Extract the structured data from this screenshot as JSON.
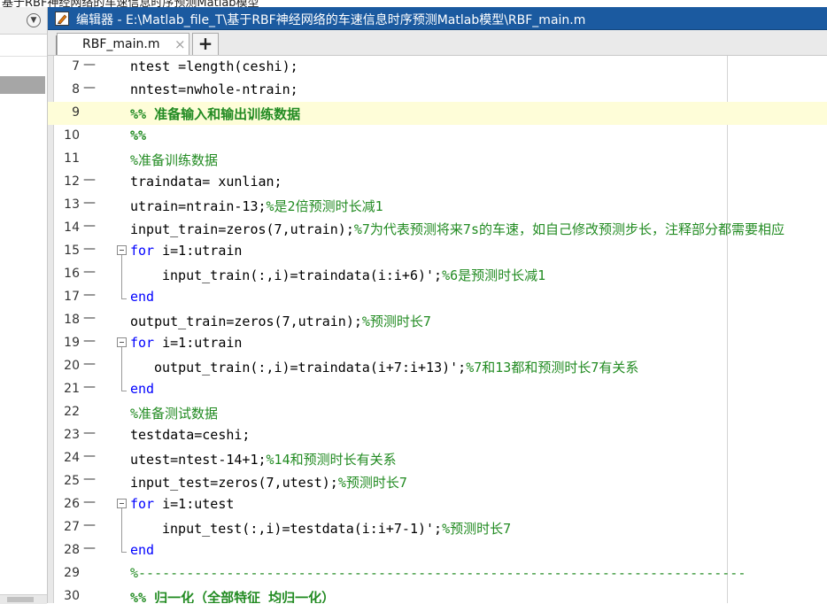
{
  "window": {
    "title_fragment": "基于RBF神经网络的车速信息时序预测Matlab模型"
  },
  "editor": {
    "title": "编辑器 - E:\\Matlab_file_T\\基于RBF神经网络的车速信息时序预测Matlab模型\\RBF_main.m",
    "tab_label": "RBF_main.m",
    "tab_close": "×",
    "add_tab": "+"
  },
  "colors": {
    "keyword": "#0000ff",
    "comment": "#228b22",
    "title_bar": "#1b5aa0",
    "cell_highlight": "#fefdd8"
  },
  "icons": {
    "editor_icon": "editor-pencil-icon",
    "panel_menu": "chevron-down-icon"
  },
  "code_lines": [
    {
      "n": "7",
      "dash": "—",
      "indent": 0,
      "fold": "",
      "highlight": false,
      "segs": [
        {
          "t": "ntest =length(ceshi);",
          "c": ""
        }
      ]
    },
    {
      "n": "8",
      "dash": "—",
      "indent": 0,
      "fold": "",
      "highlight": false,
      "segs": [
        {
          "t": "nntest=nwhole-ntrain;",
          "c": ""
        }
      ]
    },
    {
      "n": "9",
      "dash": "",
      "indent": 0,
      "fold": "",
      "highlight": true,
      "segs": [
        {
          "t": "%% 准备输入和输出训练数据",
          "c": "cell-title"
        }
      ]
    },
    {
      "n": "10",
      "dash": "",
      "indent": 0,
      "fold": "",
      "highlight": false,
      "segs": [
        {
          "t": "%%",
          "c": "cell-title"
        }
      ]
    },
    {
      "n": "11",
      "dash": "",
      "indent": 0,
      "fold": "",
      "highlight": false,
      "segs": [
        {
          "t": "%准备训练数据",
          "c": "cm"
        }
      ]
    },
    {
      "n": "12",
      "dash": "—",
      "indent": 0,
      "fold": "",
      "highlight": false,
      "segs": [
        {
          "t": "traindata= xunlian;",
          "c": ""
        }
      ]
    },
    {
      "n": "13",
      "dash": "—",
      "indent": 0,
      "fold": "",
      "highlight": false,
      "segs": [
        {
          "t": "utrain=ntrain-13;",
          "c": ""
        },
        {
          "t": "%是2倍预测时长减1",
          "c": "cm"
        }
      ]
    },
    {
      "n": "14",
      "dash": "—",
      "indent": 0,
      "fold": "",
      "highlight": false,
      "segs": [
        {
          "t": "input_train=zeros(7,utrain);",
          "c": ""
        },
        {
          "t": "%7为代表预测将来7s的车速，如自己修改预测步长，注释部分都需要相应",
          "c": "cm"
        }
      ]
    },
    {
      "n": "15",
      "dash": "—",
      "indent": 0,
      "fold": "start",
      "highlight": false,
      "segs": [
        {
          "t": "for",
          "c": "kw"
        },
        {
          "t": " i=1:utrain",
          "c": ""
        }
      ]
    },
    {
      "n": "16",
      "dash": "—",
      "indent": 1,
      "fold": "mid",
      "highlight": false,
      "segs": [
        {
          "t": "input_train(:,i)=traindata(i:i+6)';",
          "c": ""
        },
        {
          "t": "%6是预测时长减1",
          "c": "cm"
        }
      ]
    },
    {
      "n": "17",
      "dash": "—",
      "indent": 0,
      "fold": "end",
      "highlight": false,
      "segs": [
        {
          "t": "end",
          "c": "kw"
        }
      ]
    },
    {
      "n": "18",
      "dash": "—",
      "indent": 0,
      "fold": "",
      "highlight": false,
      "segs": [
        {
          "t": "output_train=zeros(7,utrain);",
          "c": ""
        },
        {
          "t": "%预测时长7",
          "c": "cm"
        }
      ]
    },
    {
      "n": "19",
      "dash": "—",
      "indent": 0,
      "fold": "start",
      "highlight": false,
      "segs": [
        {
          "t": "for",
          "c": "kw"
        },
        {
          "t": " i=1:utrain",
          "c": ""
        }
      ]
    },
    {
      "n": "20",
      "dash": "—",
      "indent": 2,
      "fold": "mid",
      "highlight": false,
      "segs": [
        {
          "t": "output_train(:,i)=traindata(i+7:i+13)';",
          "c": ""
        },
        {
          "t": "%7和13都和预测时长7有关系",
          "c": "cm"
        }
      ]
    },
    {
      "n": "21",
      "dash": "—",
      "indent": 0,
      "fold": "end",
      "highlight": false,
      "segs": [
        {
          "t": "end",
          "c": "kw"
        }
      ]
    },
    {
      "n": "22",
      "dash": "",
      "indent": 0,
      "fold": "",
      "highlight": false,
      "segs": [
        {
          "t": "%准备测试数据",
          "c": "cm"
        }
      ]
    },
    {
      "n": "23",
      "dash": "—",
      "indent": 0,
      "fold": "",
      "highlight": false,
      "segs": [
        {
          "t": "testdata=ceshi;",
          "c": ""
        }
      ]
    },
    {
      "n": "24",
      "dash": "—",
      "indent": 0,
      "fold": "",
      "highlight": false,
      "segs": [
        {
          "t": "utest=ntest-14+1;",
          "c": ""
        },
        {
          "t": "%14和预测时长有关系",
          "c": "cm"
        }
      ]
    },
    {
      "n": "25",
      "dash": "—",
      "indent": 0,
      "fold": "",
      "highlight": false,
      "segs": [
        {
          "t": "input_test=zeros(7,utest);",
          "c": ""
        },
        {
          "t": "%预测时长7",
          "c": "cm"
        }
      ]
    },
    {
      "n": "26",
      "dash": "—",
      "indent": 0,
      "fold": "start",
      "highlight": false,
      "segs": [
        {
          "t": "for",
          "c": "kw"
        },
        {
          "t": " i=1:utest",
          "c": ""
        }
      ]
    },
    {
      "n": "27",
      "dash": "—",
      "indent": 1,
      "fold": "mid",
      "highlight": false,
      "segs": [
        {
          "t": "input_test(:,i)=testdata(i:i+7-1)';",
          "c": ""
        },
        {
          "t": "%预测时长7",
          "c": "cm"
        }
      ]
    },
    {
      "n": "28",
      "dash": "—",
      "indent": 0,
      "fold": "end",
      "highlight": false,
      "segs": [
        {
          "t": "end",
          "c": "kw"
        }
      ]
    },
    {
      "n": "29",
      "dash": "",
      "indent": 0,
      "fold": "",
      "highlight": false,
      "segs": [
        {
          "t": "%----------------------------------------------------------------------------",
          "c": "cm"
        }
      ]
    },
    {
      "n": "30",
      "dash": "",
      "indent": 0,
      "fold": "",
      "highlight": false,
      "segs": [
        {
          "t": "%% 归一化（全部特征 均归一化）",
          "c": "cell-title"
        }
      ]
    }
  ]
}
